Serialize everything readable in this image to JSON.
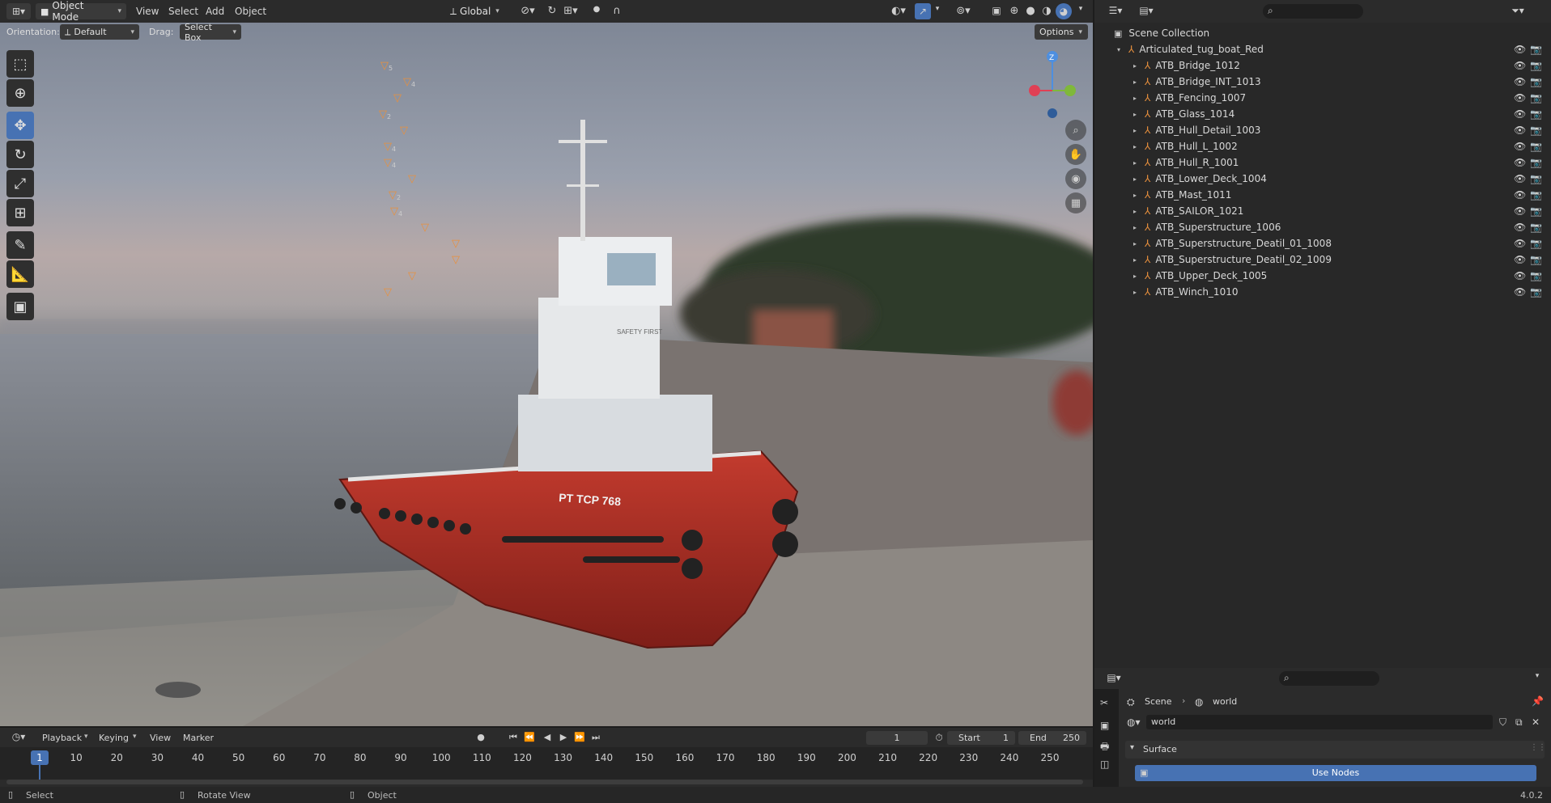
{
  "header": {
    "mode": "Object Mode",
    "menus": [
      "View",
      "Select",
      "Add",
      "Object"
    ],
    "transform_orientation": "Global",
    "orientation_label": "Orientation:",
    "orientation_value": "Default",
    "drag_label": "Drag:",
    "drag_value": "Select Box",
    "options_label": "Options"
  },
  "toolbar": {
    "tools": [
      "select-box-icon",
      "cursor-icon",
      "move-icon",
      "rotate-icon",
      "scale-icon",
      "transform-icon",
      "annotate-icon",
      "measure-icon",
      "add-cube-icon"
    ],
    "active_index": 2
  },
  "gizmo": {
    "axis_z": "Z",
    "colors": {
      "x": "#e04055",
      "y": "#7fb83a",
      "z": "#4d8fe0"
    }
  },
  "scene_text": {
    "boat_name": "PT TCP 768",
    "wheelhouse_sign": "SAFETY FIRST"
  },
  "outliner": {
    "root": "Scene Collection",
    "collection": "Articulated_tug_boat_Red",
    "items": [
      {
        "name": "ATB_Bridge_1012",
        "sub": "5"
      },
      {
        "name": "ATB_Bridge_INT_1013",
        "sub": "4"
      },
      {
        "name": "ATB_Fencing_1007",
        "sub": ""
      },
      {
        "name": "ATB_Glass_1014",
        "sub": "2"
      },
      {
        "name": "ATB_Hull_Detail_1003",
        "sub": ""
      },
      {
        "name": "ATB_Hull_L_1002",
        "sub": "4"
      },
      {
        "name": "ATB_Hull_R_1001",
        "sub": "4"
      },
      {
        "name": "ATB_Lower_Deck_1004",
        "sub": ""
      },
      {
        "name": "ATB_Mast_1011",
        "sub": "2"
      },
      {
        "name": "ATB_SAILOR_1021",
        "sub": "4"
      },
      {
        "name": "ATB_Superstructure_1006",
        "sub": ""
      },
      {
        "name": "ATB_Superstructure_Deatil_01_1008",
        "sub": ""
      },
      {
        "name": "ATB_Superstructure_Deatil_02_1009",
        "sub": ""
      },
      {
        "name": "ATB_Upper_Deck_1005",
        "sub": ""
      },
      {
        "name": "ATB_Winch_1010",
        "sub": ""
      }
    ]
  },
  "timeline": {
    "menus": [
      "Playback",
      "Keying",
      "View",
      "Marker"
    ],
    "current_frame": "1",
    "start_label": "Start",
    "start_value": "1",
    "end_label": "End",
    "end_value": "250",
    "ticks": [
      "1",
      "10",
      "20",
      "30",
      "40",
      "50",
      "60",
      "70",
      "80",
      "90",
      "100",
      "110",
      "120",
      "130",
      "140",
      "150",
      "160",
      "170",
      "180",
      "190",
      "200",
      "210",
      "220",
      "230",
      "240",
      "250"
    ]
  },
  "properties": {
    "breadcrumb_scene": "Scene",
    "breadcrumb_world": "world",
    "world_name": "world",
    "section": "Surface",
    "use_nodes": "Use Nodes"
  },
  "status": {
    "select": "Select",
    "rotate": "Rotate View",
    "object": "Object",
    "version": "4.0.2"
  },
  "colors": {
    "accent": "#4772b3",
    "panel": "#2b2b2b",
    "triangle": "#e8903d"
  }
}
